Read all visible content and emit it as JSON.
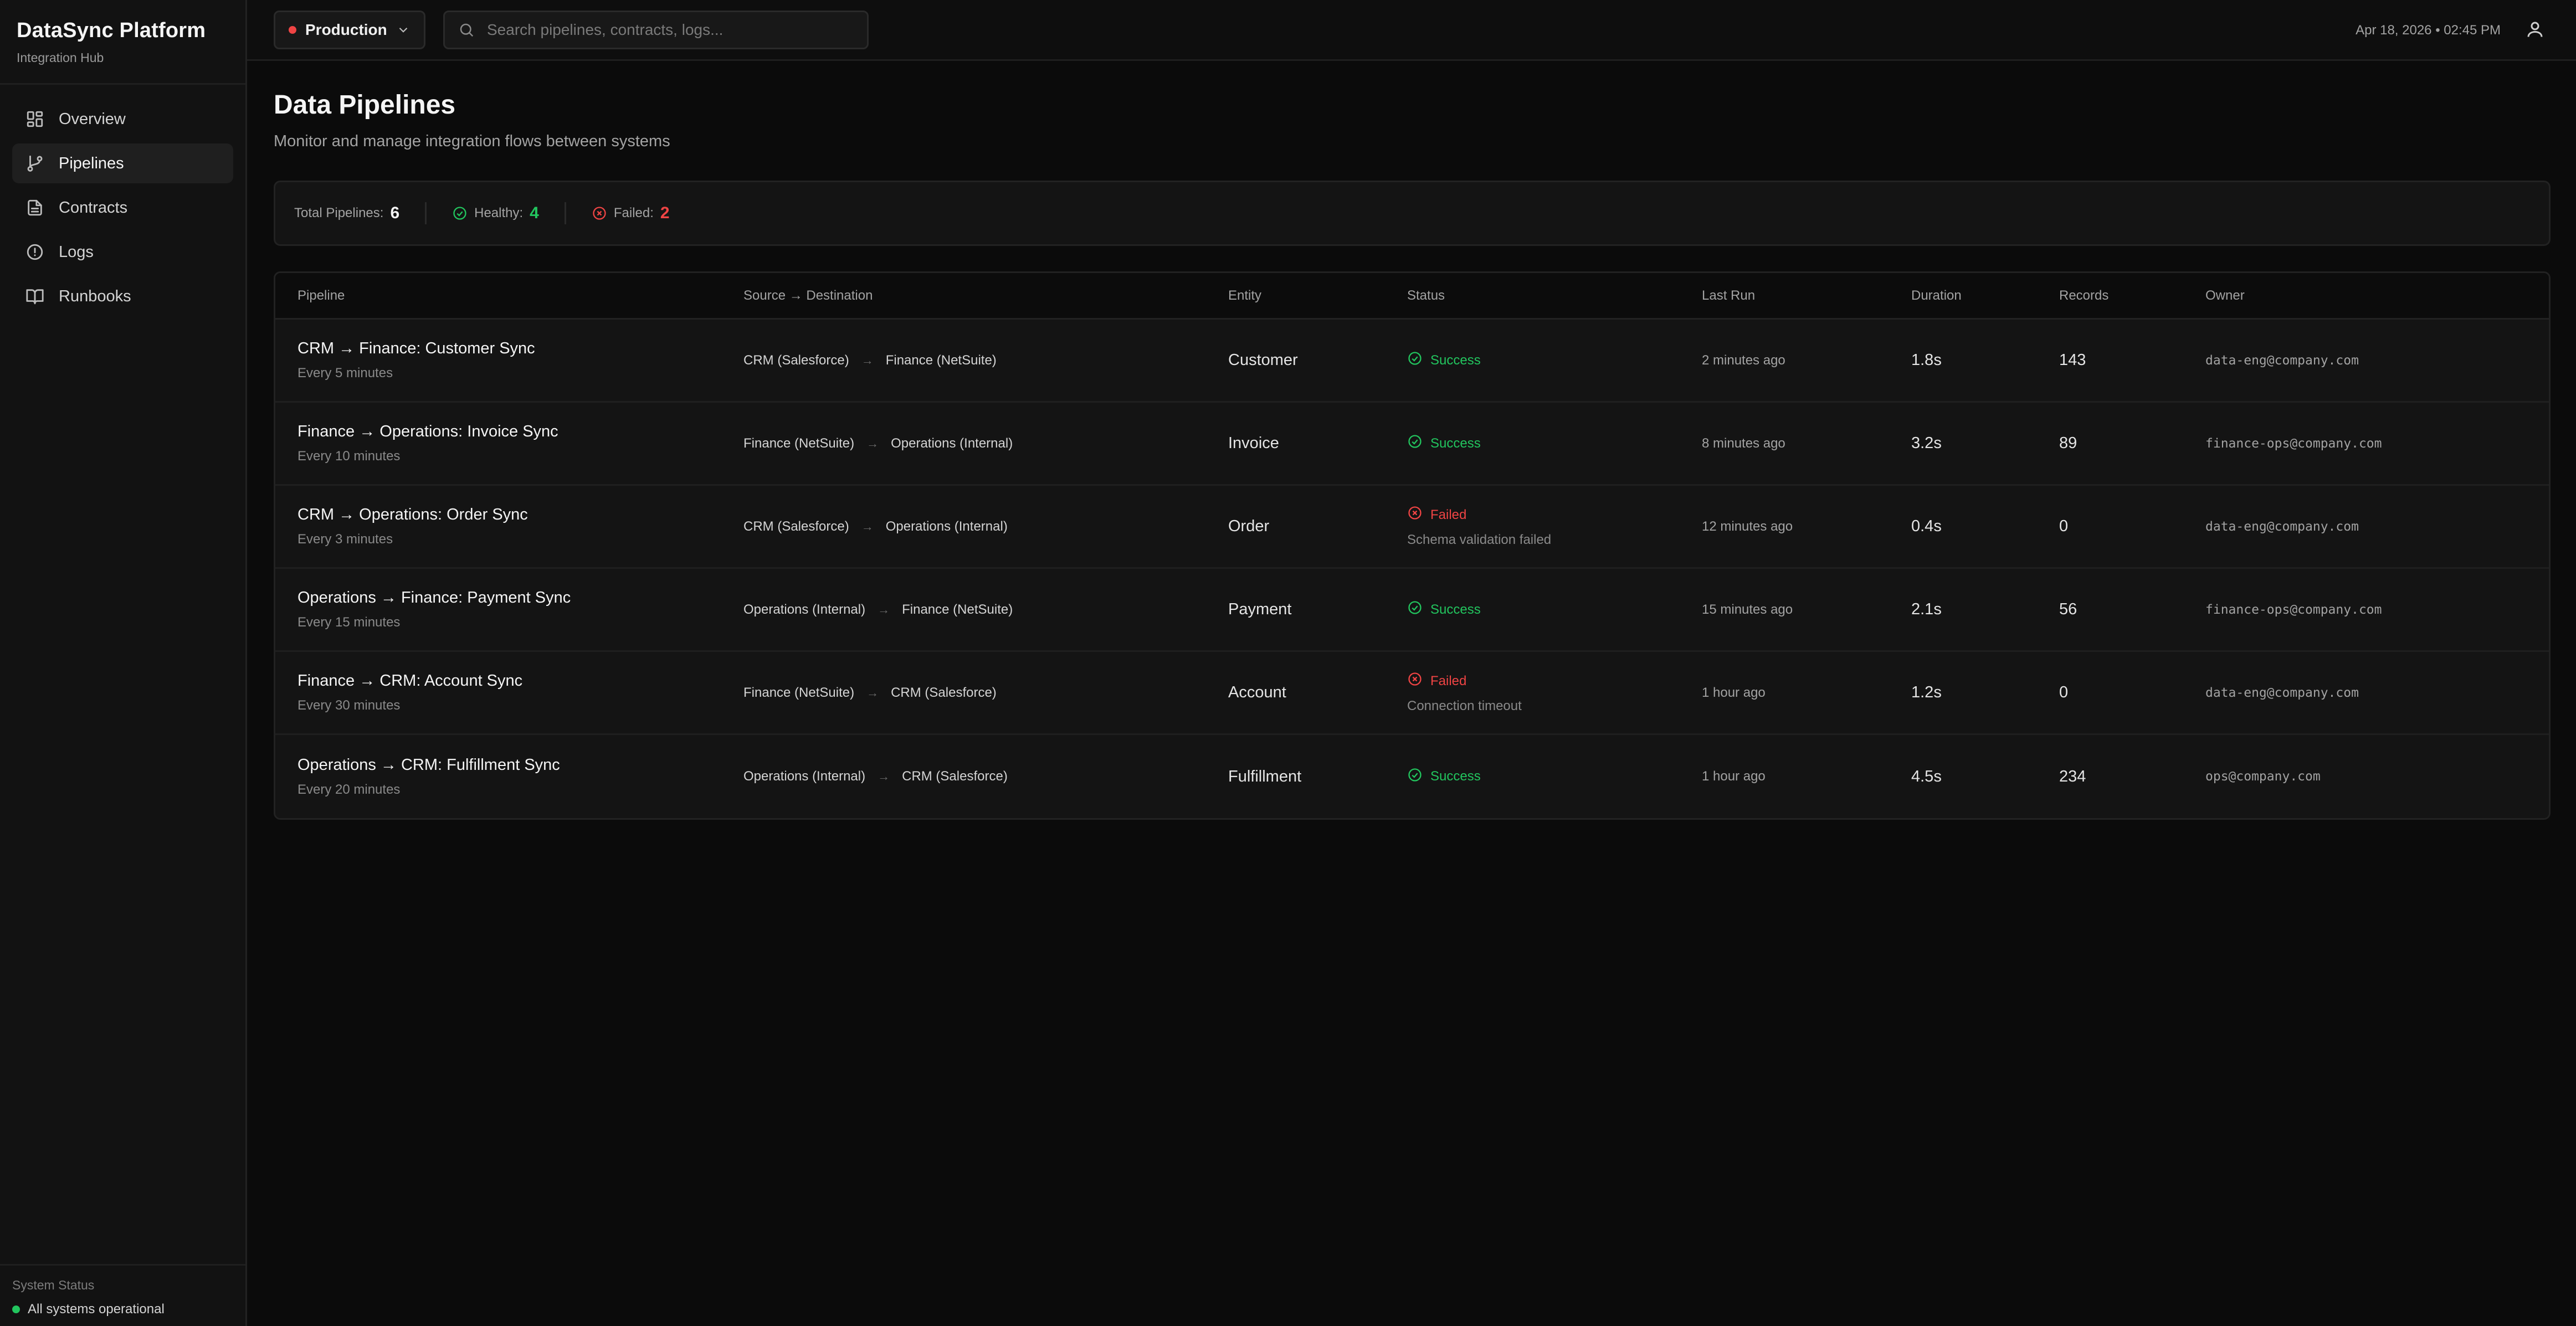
{
  "brand": {
    "title": "DataSync Platform",
    "subtitle": "Integration Hub"
  },
  "sidebar": {
    "items": [
      {
        "label": "Overview",
        "icon": "grid-icon",
        "active": false
      },
      {
        "label": "Pipelines",
        "icon": "git-branch-icon",
        "active": true
      },
      {
        "label": "Contracts",
        "icon": "document-icon",
        "active": false
      },
      {
        "label": "Logs",
        "icon": "alert-circle-icon",
        "active": false
      },
      {
        "label": "Runbooks",
        "icon": "book-icon",
        "active": false
      }
    ],
    "system_status_label": "System Status",
    "system_status_text": "All systems operational"
  },
  "topbar": {
    "environment": "Production",
    "search_placeholder": "Search pipelines, contracts, logs...",
    "datetime": "Apr 18, 2026 • 02:45 PM"
  },
  "page": {
    "title": "Data Pipelines",
    "subtitle": "Monitor and manage integration flows between systems"
  },
  "stats": {
    "total_label": "Total Pipelines:",
    "total": "6",
    "healthy_label": "Healthy:",
    "healthy": "4",
    "failed_label": "Failed:",
    "failed": "2"
  },
  "table": {
    "headers": [
      "Pipeline",
      "Source → Destination",
      "Entity",
      "Status",
      "Last Run",
      "Duration",
      "Records",
      "Owner"
    ],
    "rows": [
      {
        "name": "CRM → Finance: Customer Sync",
        "schedule": "Every 5 minutes",
        "source": "CRM (Salesforce)",
        "arrow": "→",
        "destination": "Finance (NetSuite)",
        "entity": "Customer",
        "status": "Success",
        "error": "",
        "last_run": "2 minutes ago",
        "duration": "1.8s",
        "records": "143",
        "owner": "data-eng@company.com"
      },
      {
        "name": "Finance → Operations: Invoice Sync",
        "schedule": "Every 10 minutes",
        "source": "Finance (NetSuite)",
        "arrow": "→",
        "destination": "Operations (Internal)",
        "entity": "Invoice",
        "status": "Success",
        "error": "",
        "last_run": "8 minutes ago",
        "duration": "3.2s",
        "records": "89",
        "owner": "finance-ops@company.com"
      },
      {
        "name": "CRM → Operations: Order Sync",
        "schedule": "Every 3 minutes",
        "source": "CRM (Salesforce)",
        "arrow": "→",
        "destination": "Operations (Internal)",
        "entity": "Order",
        "status": "Failed",
        "error": "Schema validation failed",
        "last_run": "12 minutes ago",
        "duration": "0.4s",
        "records": "0",
        "owner": "data-eng@company.com"
      },
      {
        "name": "Operations → Finance: Payment Sync",
        "schedule": "Every 15 minutes",
        "source": "Operations (Internal)",
        "arrow": "→",
        "destination": "Finance (NetSuite)",
        "entity": "Payment",
        "status": "Success",
        "error": "",
        "last_run": "15 minutes ago",
        "duration": "2.1s",
        "records": "56",
        "owner": "finance-ops@company.com"
      },
      {
        "name": "Finance → CRM: Account Sync",
        "schedule": "Every 30 minutes",
        "source": "Finance (NetSuite)",
        "arrow": "→",
        "destination": "CRM (Salesforce)",
        "entity": "Account",
        "status": "Failed",
        "error": "Connection timeout",
        "last_run": "1 hour ago",
        "duration": "1.2s",
        "records": "0",
        "owner": "data-eng@company.com"
      },
      {
        "name": "Operations → CRM: Fulfillment Sync",
        "schedule": "Every 20 minutes",
        "source": "Operations (Internal)",
        "arrow": "→",
        "destination": "CRM (Salesforce)",
        "entity": "Fulfillment",
        "status": "Success",
        "error": "",
        "last_run": "1 hour ago",
        "duration": "4.5s",
        "records": "234",
        "owner": "ops@company.com"
      }
    ]
  },
  "colors": {
    "success": "#22c55e",
    "failed": "#ef4444",
    "background": "#0b0b0b",
    "sidebar": "#121212"
  }
}
